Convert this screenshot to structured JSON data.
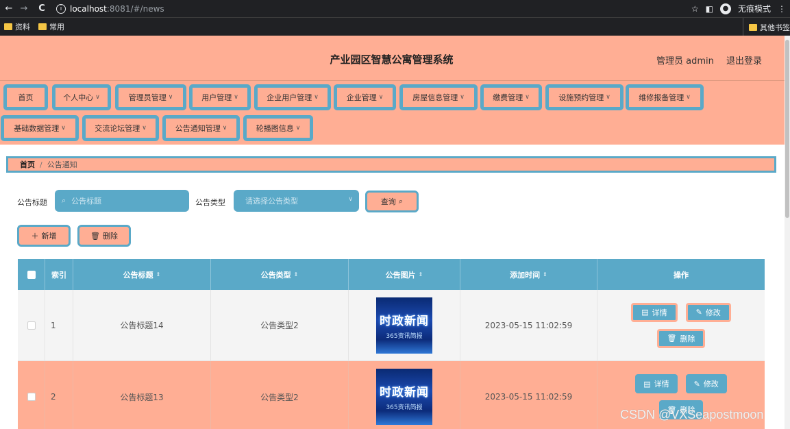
{
  "browser": {
    "url_host": "localhost",
    "url_path": ":8081/#/news",
    "incognito_label": "无痕模式",
    "bookmarks": [
      "资料",
      "常用"
    ],
    "bookmarks_right": "其他书签"
  },
  "header": {
    "title": "产业园区智慧公寓管理系统",
    "user": "管理员 admin",
    "logout": "退出登录"
  },
  "menu": [
    "首页",
    "个人中心",
    "管理员管理",
    "用户管理",
    "企业用户管理",
    "企业管理",
    "房屋信息管理",
    "缴费管理",
    "设施预约管理",
    "维修报备管理",
    "基础数据管理",
    "交流论坛管理",
    "公告通知管理",
    "轮播图信息"
  ],
  "breadcrumb": {
    "home": "首页",
    "current": "公告通知"
  },
  "search": {
    "title_label": "公告标题",
    "title_placeholder": "公告标题",
    "type_label": "公告类型",
    "type_placeholder": "请选择公告类型",
    "query_button": "查询",
    "add_button": "新增",
    "delete_button": "删除"
  },
  "table": {
    "columns": [
      "索引",
      "公告标题",
      "公告类型",
      "公告图片",
      "添加时间",
      "操作"
    ],
    "rows": [
      {
        "index": "1",
        "title": "公告标题14",
        "type": "公告类型2",
        "image_text": "时政新闻",
        "image_sub": "365资讯简报",
        "time": "2023-05-15 11:02:59"
      },
      {
        "index": "2",
        "title": "公告标题13",
        "type": "公告类型2",
        "image_text": "时政新闻",
        "image_sub": "365资讯简报",
        "time": "2023-05-15 11:02:59"
      }
    ],
    "actions": {
      "detail": "详情",
      "edit": "修改",
      "delete": "删除"
    }
  },
  "watermark": "CSDN @VXSeapostmoon"
}
